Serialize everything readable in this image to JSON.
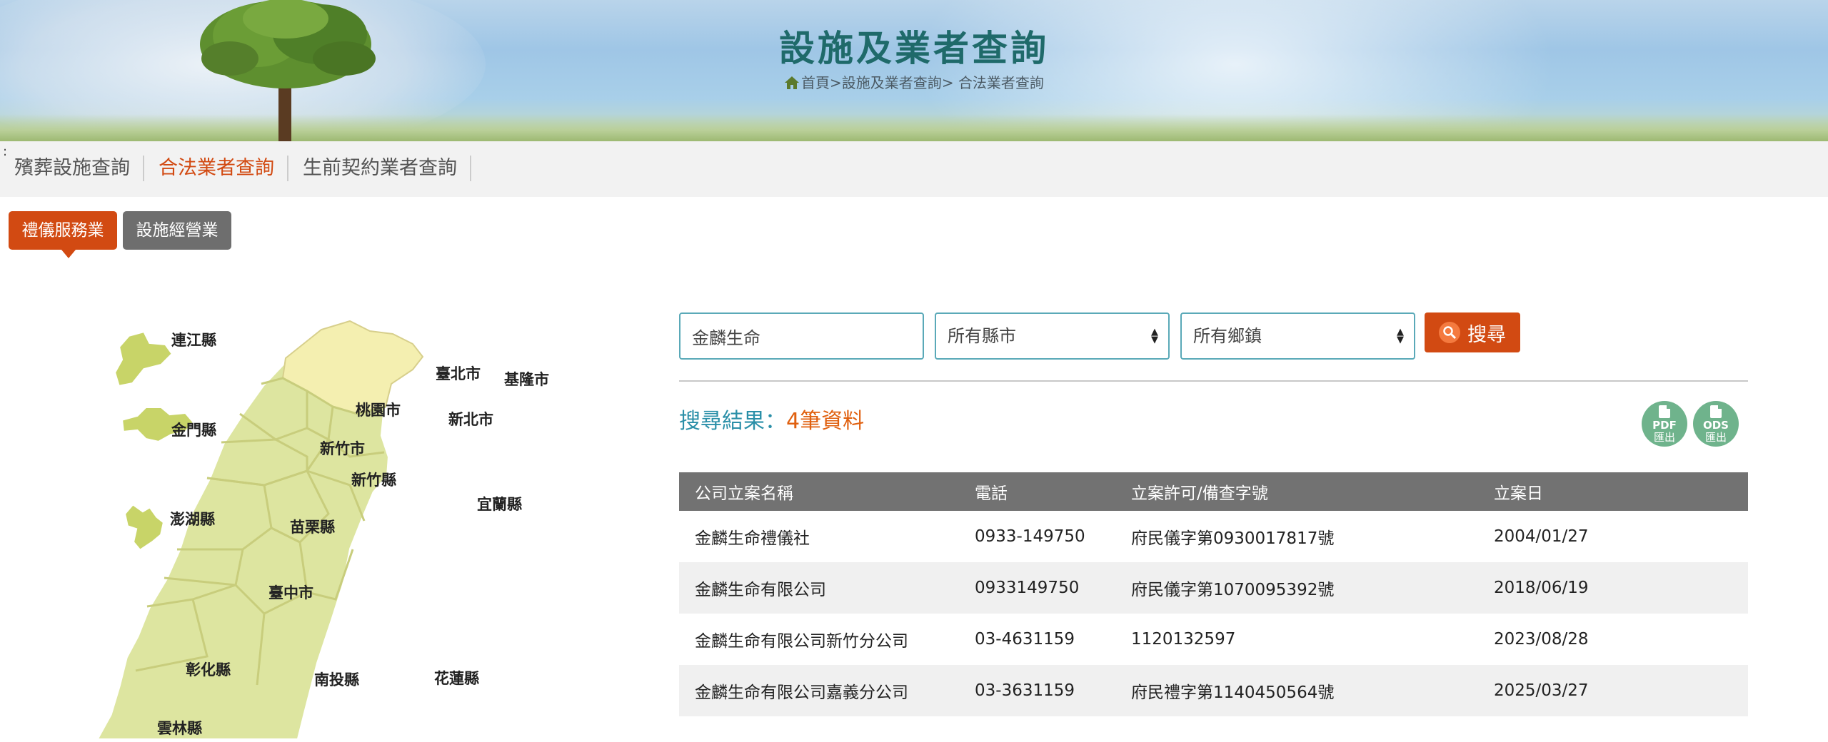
{
  "banner": {
    "title": "設施及業者查詢",
    "breadcrumb": [
      "首頁",
      "設施及業者查詢",
      "合法業者查詢"
    ]
  },
  "subnav": {
    "marker": ":",
    "items": [
      {
        "label": "殯葬設施查詢",
        "active": false
      },
      {
        "label": "合法業者查詢",
        "active": true
      },
      {
        "label": "生前契約業者查詢",
        "active": false
      }
    ]
  },
  "category_tabs": [
    {
      "label": "禮儀服務業",
      "active": true
    },
    {
      "label": "設施經營業",
      "active": false
    }
  ],
  "map": {
    "labels": [
      "連江縣",
      "金門縣",
      "澎湖縣",
      "臺北市",
      "基隆市",
      "桃園市",
      "新北市",
      "新竹市",
      "新竹縣",
      "宜蘭縣",
      "苗栗縣",
      "臺中市",
      "彰化縣",
      "南投縣",
      "花蓮縣",
      "雲林縣"
    ],
    "fill_color": "#dde5a0",
    "north_color": "#f4efb0",
    "outline_color": "#ffffff"
  },
  "search": {
    "keyword_value": "金麟生命",
    "county_select": "所有縣市",
    "town_select": "所有鄉鎮",
    "button_label": "搜尋"
  },
  "results": {
    "label": "搜尋結果：",
    "count_text": "4筆資料"
  },
  "exports": [
    {
      "format": "PDF",
      "action": "匯出"
    },
    {
      "format": "ODS",
      "action": "匯出"
    }
  ],
  "table": {
    "headers": [
      "公司立案名稱",
      "電話",
      "立案許可/備查字號",
      "立案日"
    ],
    "rows": [
      [
        "金麟生命禮儀社",
        "0933-149750",
        "府民儀字第0930017817號",
        "2004/01/27"
      ],
      [
        "金麟生命有限公司",
        "0933149750",
        "府民儀字第1070095392號",
        "2018/06/19"
      ],
      [
        "金麟生命有限公司新竹分公司",
        "03-4631159",
        "1120132597",
        "2023/08/28"
      ],
      [
        "金麟生命有限公司嘉義分公司",
        "03-3631159",
        "府民禮字第1140450564號",
        "2025/03/27"
      ]
    ]
  },
  "colors": {
    "accent": "#d24a12",
    "teal": "#1f6a6a",
    "result_blue": "#2a8fa8",
    "header_gray": "#727272",
    "export_green": "#6fb38c"
  }
}
